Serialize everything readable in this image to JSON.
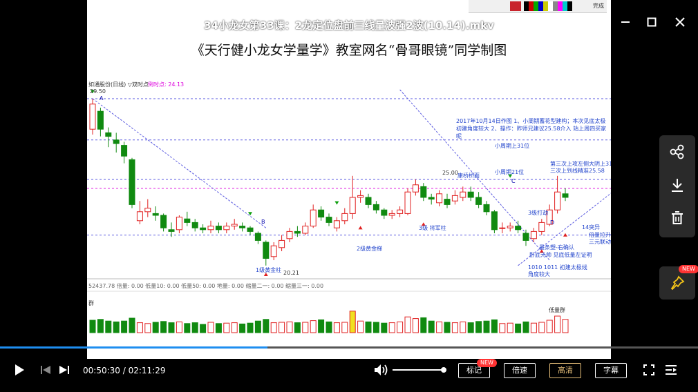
{
  "window": {
    "title": "34小龙女第33课：2龙定位盘前三线量波强2波(10.14).mkv",
    "minimize_icon": "minimize-icon",
    "maximize_icon": "maximize-icon",
    "close_icon": "close-icon"
  },
  "slide": {
    "heading": "《天行健小龙女学量学》教室网名“骨哥眼镜”同学制图",
    "top_toolbar_label": "完成",
    "chart_header": "如通股份(日线) ▽双时点",
    "chart_header_value": "倒时点: 24.13",
    "start_price": "29.50",
    "low_price": "20.21",
    "level_25": "25.00",
    "level_25_58": "25.58",
    "note_top": "2017年10月14日作图 1、小周期蓄花型建构；本次见底太极 初建角度较大 2、操作：昨师兄建议25.58介入 站上周四买家呢",
    "lbl_small_cycle_31": "小周期上31位",
    "lbl_small_cycle_21": "小周期21位",
    "lbl_third_tide": "第三次上攻左侧大阴上31",
    "lbl_third_tide_2": "三次上到线精准25.58",
    "lbl_kanqiao": "康桥桥面",
    "lbl_3_ji_da_ji": "3级打劫",
    "lbl_3_ji_jiang_jun": "3级 将军柱",
    "lbl_2_ji": "2级黄金梯",
    "lbl_1_ji": "1级黄金柱",
    "lbl_14_tubu": "14突异",
    "lbl_beiliang": "倍量拉升",
    "lbl_sanyuan": "三元联动",
    "lbl_huitiao": "墨条塑-右确认",
    "lbl_jiedi": "卧底元帅 见底低量左证明",
    "lbl_1010": "1010 1011 初建太极线",
    "lbl_jiaodu": "角度较大",
    "lbl_indicators": "52437.78 倍量: 0.00 低量10: 0.00 低量50: 0.00 地量: 0.00 缩量二一: 0.00 缩量三一: 0.00",
    "lbl_volume_bottom": "低量群",
    "lbl_vol_left": "群",
    "letter_a": "A",
    "letter_b": "B",
    "letter_c": "C",
    "letter_d": "D",
    "vol_marks": "3"
  },
  "chart_data": {
    "type": "candlestick",
    "title": "",
    "note": "Candles read approximately from the chart",
    "candles": [
      {
        "o": 27.8,
        "c": 29.2,
        "h": 29.5,
        "l": 27.5
      },
      {
        "o": 28.8,
        "c": 27.8,
        "h": 29.0,
        "l": 27.4
      },
      {
        "o": 27.6,
        "c": 27.4,
        "h": 27.9,
        "l": 26.8
      },
      {
        "o": 27.2,
        "c": 27.0,
        "h": 27.6,
        "l": 26.5
      },
      {
        "o": 26.9,
        "c": 26.3,
        "h": 27.1,
        "l": 25.9
      },
      {
        "o": 26.1,
        "c": 23.6,
        "h": 26.2,
        "l": 23.4
      },
      {
        "o": 22.7,
        "c": 23.2,
        "h": 23.8,
        "l": 22.5
      },
      {
        "o": 23.2,
        "c": 23.4,
        "h": 23.9,
        "l": 22.9
      },
      {
        "o": 23.1,
        "c": 23.0,
        "h": 23.5,
        "l": 22.7
      },
      {
        "o": 23.0,
        "c": 22.3,
        "h": 23.1,
        "l": 22.1
      },
      {
        "o": 22.2,
        "c": 22.1,
        "h": 22.6,
        "l": 21.8
      },
      {
        "o": 22.2,
        "c": 22.9,
        "h": 23.0,
        "l": 22.0
      },
      {
        "o": 22.8,
        "c": 22.6,
        "h": 23.2,
        "l": 22.4
      },
      {
        "o": 22.6,
        "c": 22.3,
        "h": 22.8,
        "l": 22.1
      },
      {
        "o": 22.3,
        "c": 22.2,
        "h": 22.5,
        "l": 22.0
      },
      {
        "o": 22.2,
        "c": 22.4,
        "h": 22.7,
        "l": 22.0
      },
      {
        "o": 22.4,
        "c": 22.2,
        "h": 22.6,
        "l": 22.0
      },
      {
        "o": 22.2,
        "c": 22.4,
        "h": 22.6,
        "l": 22.0
      },
      {
        "o": 22.4,
        "c": 22.5,
        "h": 22.8,
        "l": 22.2
      },
      {
        "o": 22.4,
        "c": 22.3,
        "h": 22.6,
        "l": 22.1
      },
      {
        "o": 22.3,
        "c": 22.1,
        "h": 22.4,
        "l": 21.9
      },
      {
        "o": 22.0,
        "c": 21.6,
        "h": 22.1,
        "l": 21.4
      },
      {
        "o": 21.5,
        "c": 20.6,
        "h": 21.6,
        "l": 20.2
      },
      {
        "o": 20.7,
        "c": 21.3,
        "h": 21.5,
        "l": 20.5
      },
      {
        "o": 21.2,
        "c": 21.6,
        "h": 21.9,
        "l": 21.0
      },
      {
        "o": 21.7,
        "c": 22.1,
        "h": 22.3,
        "l": 21.5
      },
      {
        "o": 22.1,
        "c": 22.0,
        "h": 22.4,
        "l": 21.8
      },
      {
        "o": 22.0,
        "c": 22.4,
        "h": 22.6,
        "l": 21.9
      },
      {
        "o": 22.4,
        "c": 23.3,
        "h": 23.6,
        "l": 22.3
      },
      {
        "o": 23.3,
        "c": 22.9,
        "h": 23.5,
        "l": 22.7
      },
      {
        "o": 22.9,
        "c": 22.6,
        "h": 23.1,
        "l": 22.4
      },
      {
        "o": 22.3,
        "c": 22.7,
        "h": 22.9,
        "l": 22.1
      },
      {
        "o": 22.7,
        "c": 23.1,
        "h": 23.4,
        "l": 22.5
      },
      {
        "o": 23.1,
        "c": 24.0,
        "h": 25.2,
        "l": 22.8
      },
      {
        "o": 24.0,
        "c": 24.1,
        "h": 24.4,
        "l": 23.7
      },
      {
        "o": 24.0,
        "c": 23.6,
        "h": 24.2,
        "l": 23.4
      },
      {
        "o": 23.6,
        "c": 23.3,
        "h": 23.8,
        "l": 23.1
      },
      {
        "o": 23.3,
        "c": 23.0,
        "h": 23.4,
        "l": 22.8
      },
      {
        "o": 23.0,
        "c": 23.1,
        "h": 23.3,
        "l": 22.8
      },
      {
        "o": 23.1,
        "c": 23.3,
        "h": 23.5,
        "l": 22.9
      },
      {
        "o": 23.1,
        "c": 24.3,
        "h": 24.5,
        "l": 23.0
      },
      {
        "o": 24.3,
        "c": 24.7,
        "h": 25.0,
        "l": 24.1
      },
      {
        "o": 24.6,
        "c": 24.0,
        "h": 24.8,
        "l": 23.8
      },
      {
        "o": 24.0,
        "c": 23.9,
        "h": 24.2,
        "l": 23.6
      },
      {
        "o": 23.7,
        "c": 24.2,
        "h": 24.4,
        "l": 23.5
      },
      {
        "o": 23.9,
        "c": 23.6,
        "h": 24.2,
        "l": 23.4
      },
      {
        "o": 23.8,
        "c": 24.1,
        "h": 24.4,
        "l": 23.6
      },
      {
        "o": 24.0,
        "c": 24.3,
        "h": 24.6,
        "l": 23.8
      },
      {
        "o": 24.3,
        "c": 24.0,
        "h": 24.6,
        "l": 23.8
      },
      {
        "o": 24.0,
        "c": 23.6,
        "h": 24.3,
        "l": 23.4
      },
      {
        "o": 23.6,
        "c": 23.2,
        "h": 23.8,
        "l": 23.0
      },
      {
        "o": 23.2,
        "c": 22.2,
        "h": 23.3,
        "l": 22.0
      },
      {
        "o": 22.3,
        "c": 22.3,
        "h": 22.6,
        "l": 22.0
      },
      {
        "o": 22.3,
        "c": 22.4,
        "h": 22.6,
        "l": 22.1
      },
      {
        "o": 22.4,
        "c": 22.2,
        "h": 22.7,
        "l": 22.0
      },
      {
        "o": 22.0,
        "c": 21.6,
        "h": 22.2,
        "l": 21.3
      },
      {
        "o": 21.7,
        "c": 22.1,
        "h": 22.3,
        "l": 21.5
      },
      {
        "o": 22.1,
        "c": 22.6,
        "h": 22.8,
        "l": 21.9
      },
      {
        "o": 22.5,
        "c": 23.3,
        "h": 23.6,
        "l": 22.4
      },
      {
        "o": 23.3,
        "c": 24.3,
        "h": 25.2,
        "l": 23.1
      },
      {
        "o": 24.2,
        "c": 24.0,
        "h": 24.5,
        "l": 23.8
      }
    ],
    "volumes": [
      {
        "v": 3.0,
        "up": false
      },
      {
        "v": 3.2,
        "up": false
      },
      {
        "v": 2.8,
        "up": false
      },
      {
        "v": 2.6,
        "up": false
      },
      {
        "v": 2.8,
        "up": false
      },
      {
        "v": 3.5,
        "up": false
      },
      {
        "v": 2.4,
        "up": true
      },
      {
        "v": 2.2,
        "up": true
      },
      {
        "v": 2.5,
        "up": false
      },
      {
        "v": 2.7,
        "up": false
      },
      {
        "v": 2.4,
        "up": false
      },
      {
        "v": 2.6,
        "up": true
      },
      {
        "v": 2.2,
        "up": false
      },
      {
        "v": 2.4,
        "up": false
      },
      {
        "v": 2.0,
        "up": false
      },
      {
        "v": 2.5,
        "up": true
      },
      {
        "v": 2.2,
        "up": false
      },
      {
        "v": 2.3,
        "up": true
      },
      {
        "v": 2.4,
        "up": true
      },
      {
        "v": 2.1,
        "up": false
      },
      {
        "v": 2.3,
        "up": false
      },
      {
        "v": 2.8,
        "up": false
      },
      {
        "v": 3.2,
        "up": false
      },
      {
        "v": 2.4,
        "up": true
      },
      {
        "v": 2.5,
        "up": true
      },
      {
        "v": 2.6,
        "up": true
      },
      {
        "v": 2.4,
        "up": false
      },
      {
        "v": 2.5,
        "up": true
      },
      {
        "v": 2.9,
        "up": true
      },
      {
        "v": 3.1,
        "up": false
      },
      {
        "v": 2.6,
        "up": false
      },
      {
        "v": 2.4,
        "up": true
      },
      {
        "v": 2.5,
        "up": true
      },
      {
        "v": 5.2,
        "up": true
      },
      {
        "v": 2.8,
        "up": true
      },
      {
        "v": 2.6,
        "up": false
      },
      {
        "v": 2.5,
        "up": false
      },
      {
        "v": 2.3,
        "up": false
      },
      {
        "v": 2.4,
        "up": true
      },
      {
        "v": 2.6,
        "up": true
      },
      {
        "v": 3.8,
        "up": true
      },
      {
        "v": 3.4,
        "up": true
      },
      {
        "v": 3.6,
        "up": false
      },
      {
        "v": 2.8,
        "up": false
      },
      {
        "v": 2.6,
        "up": true
      },
      {
        "v": 2.5,
        "up": false
      },
      {
        "v": 2.4,
        "up": true
      },
      {
        "v": 2.6,
        "up": true
      },
      {
        "v": 2.4,
        "up": false
      },
      {
        "v": 2.7,
        "up": false
      },
      {
        "v": 2.8,
        "up": false
      },
      {
        "v": 3.1,
        "up": false
      },
      {
        "v": 2.2,
        "up": true
      },
      {
        "v": 2.3,
        "up": true
      },
      {
        "v": 2.1,
        "up": false
      },
      {
        "v": 2.6,
        "up": false
      },
      {
        "v": 2.3,
        "up": true
      },
      {
        "v": 2.5,
        "up": true
      },
      {
        "v": 3.0,
        "up": true
      },
      {
        "v": 4.0,
        "up": true
      },
      {
        "v": 3.2,
        "up": true
      }
    ],
    "horizontal_levels": [
      29.5,
      27.2,
      25.0,
      24.5,
      21.9
    ],
    "price_range": [
      20.0,
      30.0
    ]
  },
  "player": {
    "current_time": "00:50:30",
    "total_time": "02:11:29",
    "progress": 0.383,
    "volume": 0.95,
    "btn_marks": "标记",
    "btn_speed": "倍速",
    "btn_quality": "高清",
    "btn_subtitle": "字幕",
    "badge_new": "NEW",
    "accent": "#1e8ef0",
    "quality_color": "#e8c07a"
  },
  "side_panel": {
    "share_icon": "share-icon",
    "download_icon": "download-icon",
    "delete_icon": "trash-icon",
    "pin_icon": "pin-icon",
    "badge_new": "NEW"
  }
}
